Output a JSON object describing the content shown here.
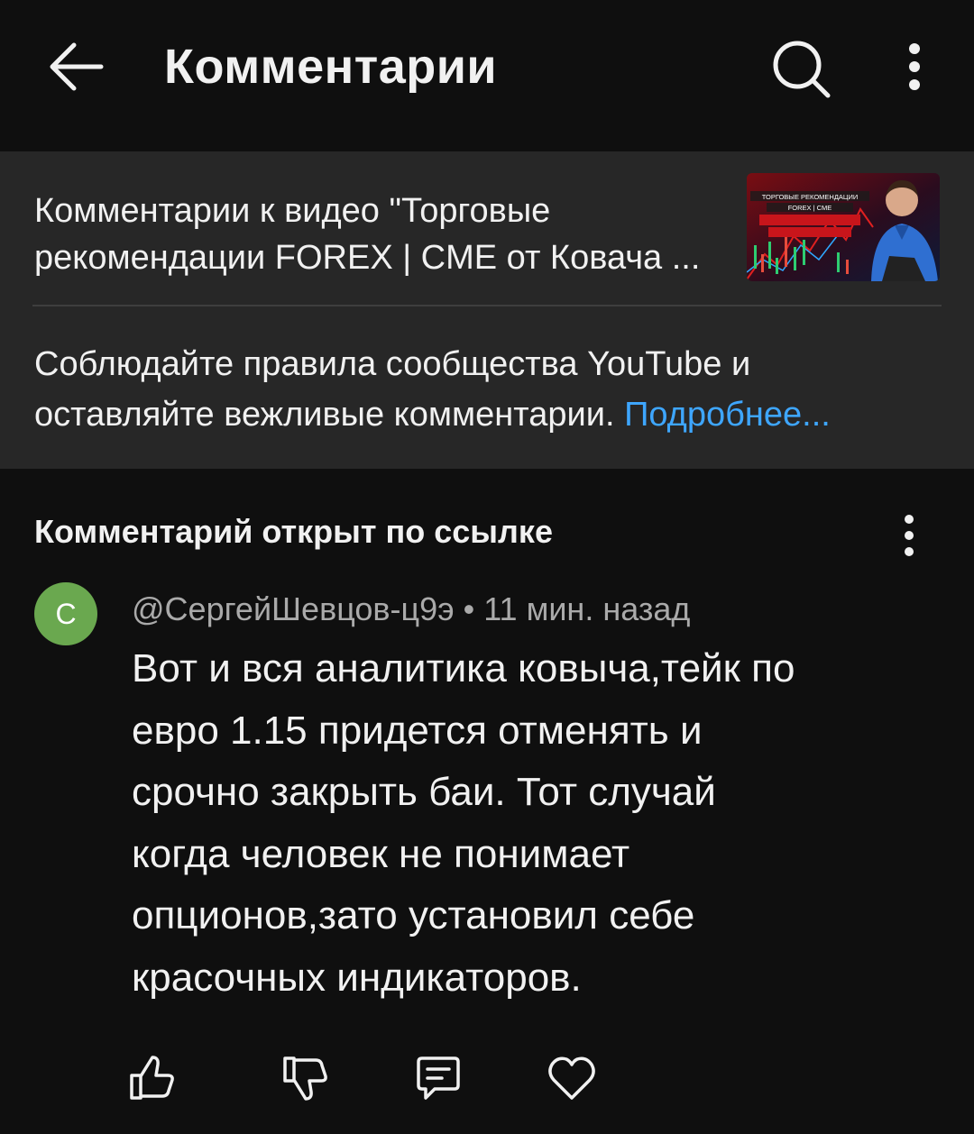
{
  "header": {
    "title": "Комментарии",
    "back_icon": "arrow-left-icon",
    "search_icon": "search-icon",
    "menu_icon": "more-vertical-icon"
  },
  "info": {
    "video_title_line1": "Комментарии к видео \"Торговые",
    "video_title_line2": "рекомендации FOREX | CME от Ковача ...",
    "thumbnail_caption_line1": "ТОРГОВЫЕ РЕКОМЕНДАЦИИ",
    "thumbnail_caption_line2": "FOREX | CME",
    "rules_line1": "Соблюдайте правила сообщества YouTube и",
    "rules_line2": "оставляйте вежливые комментарии.",
    "rules_link": "Подробнее..."
  },
  "comment": {
    "section_title": "Комментарий открыт по ссылке",
    "avatar_letter": "С",
    "avatar_color": "#6aa84f",
    "author": "@СергейШевцов-ц9э",
    "separator": "•",
    "time": "11 мин. назад",
    "lines": [
      "Вот и вся аналитика ковыча,тейк по",
      "евро 1.15 придется отменять и",
      "срочно закрыть баи. Тот случай",
      "когда человек не понимает",
      "опционов,зато установил себе",
      "красочных индикаторов."
    ],
    "actions": [
      "thumbs-up-icon",
      "thumbs-down-icon",
      "reply-icon",
      "heart-icon"
    ]
  },
  "colors": {
    "background": "#0f0f0f",
    "panel": "#272727",
    "link": "#3ea6ff",
    "secondary_text": "#aaaaaa"
  }
}
